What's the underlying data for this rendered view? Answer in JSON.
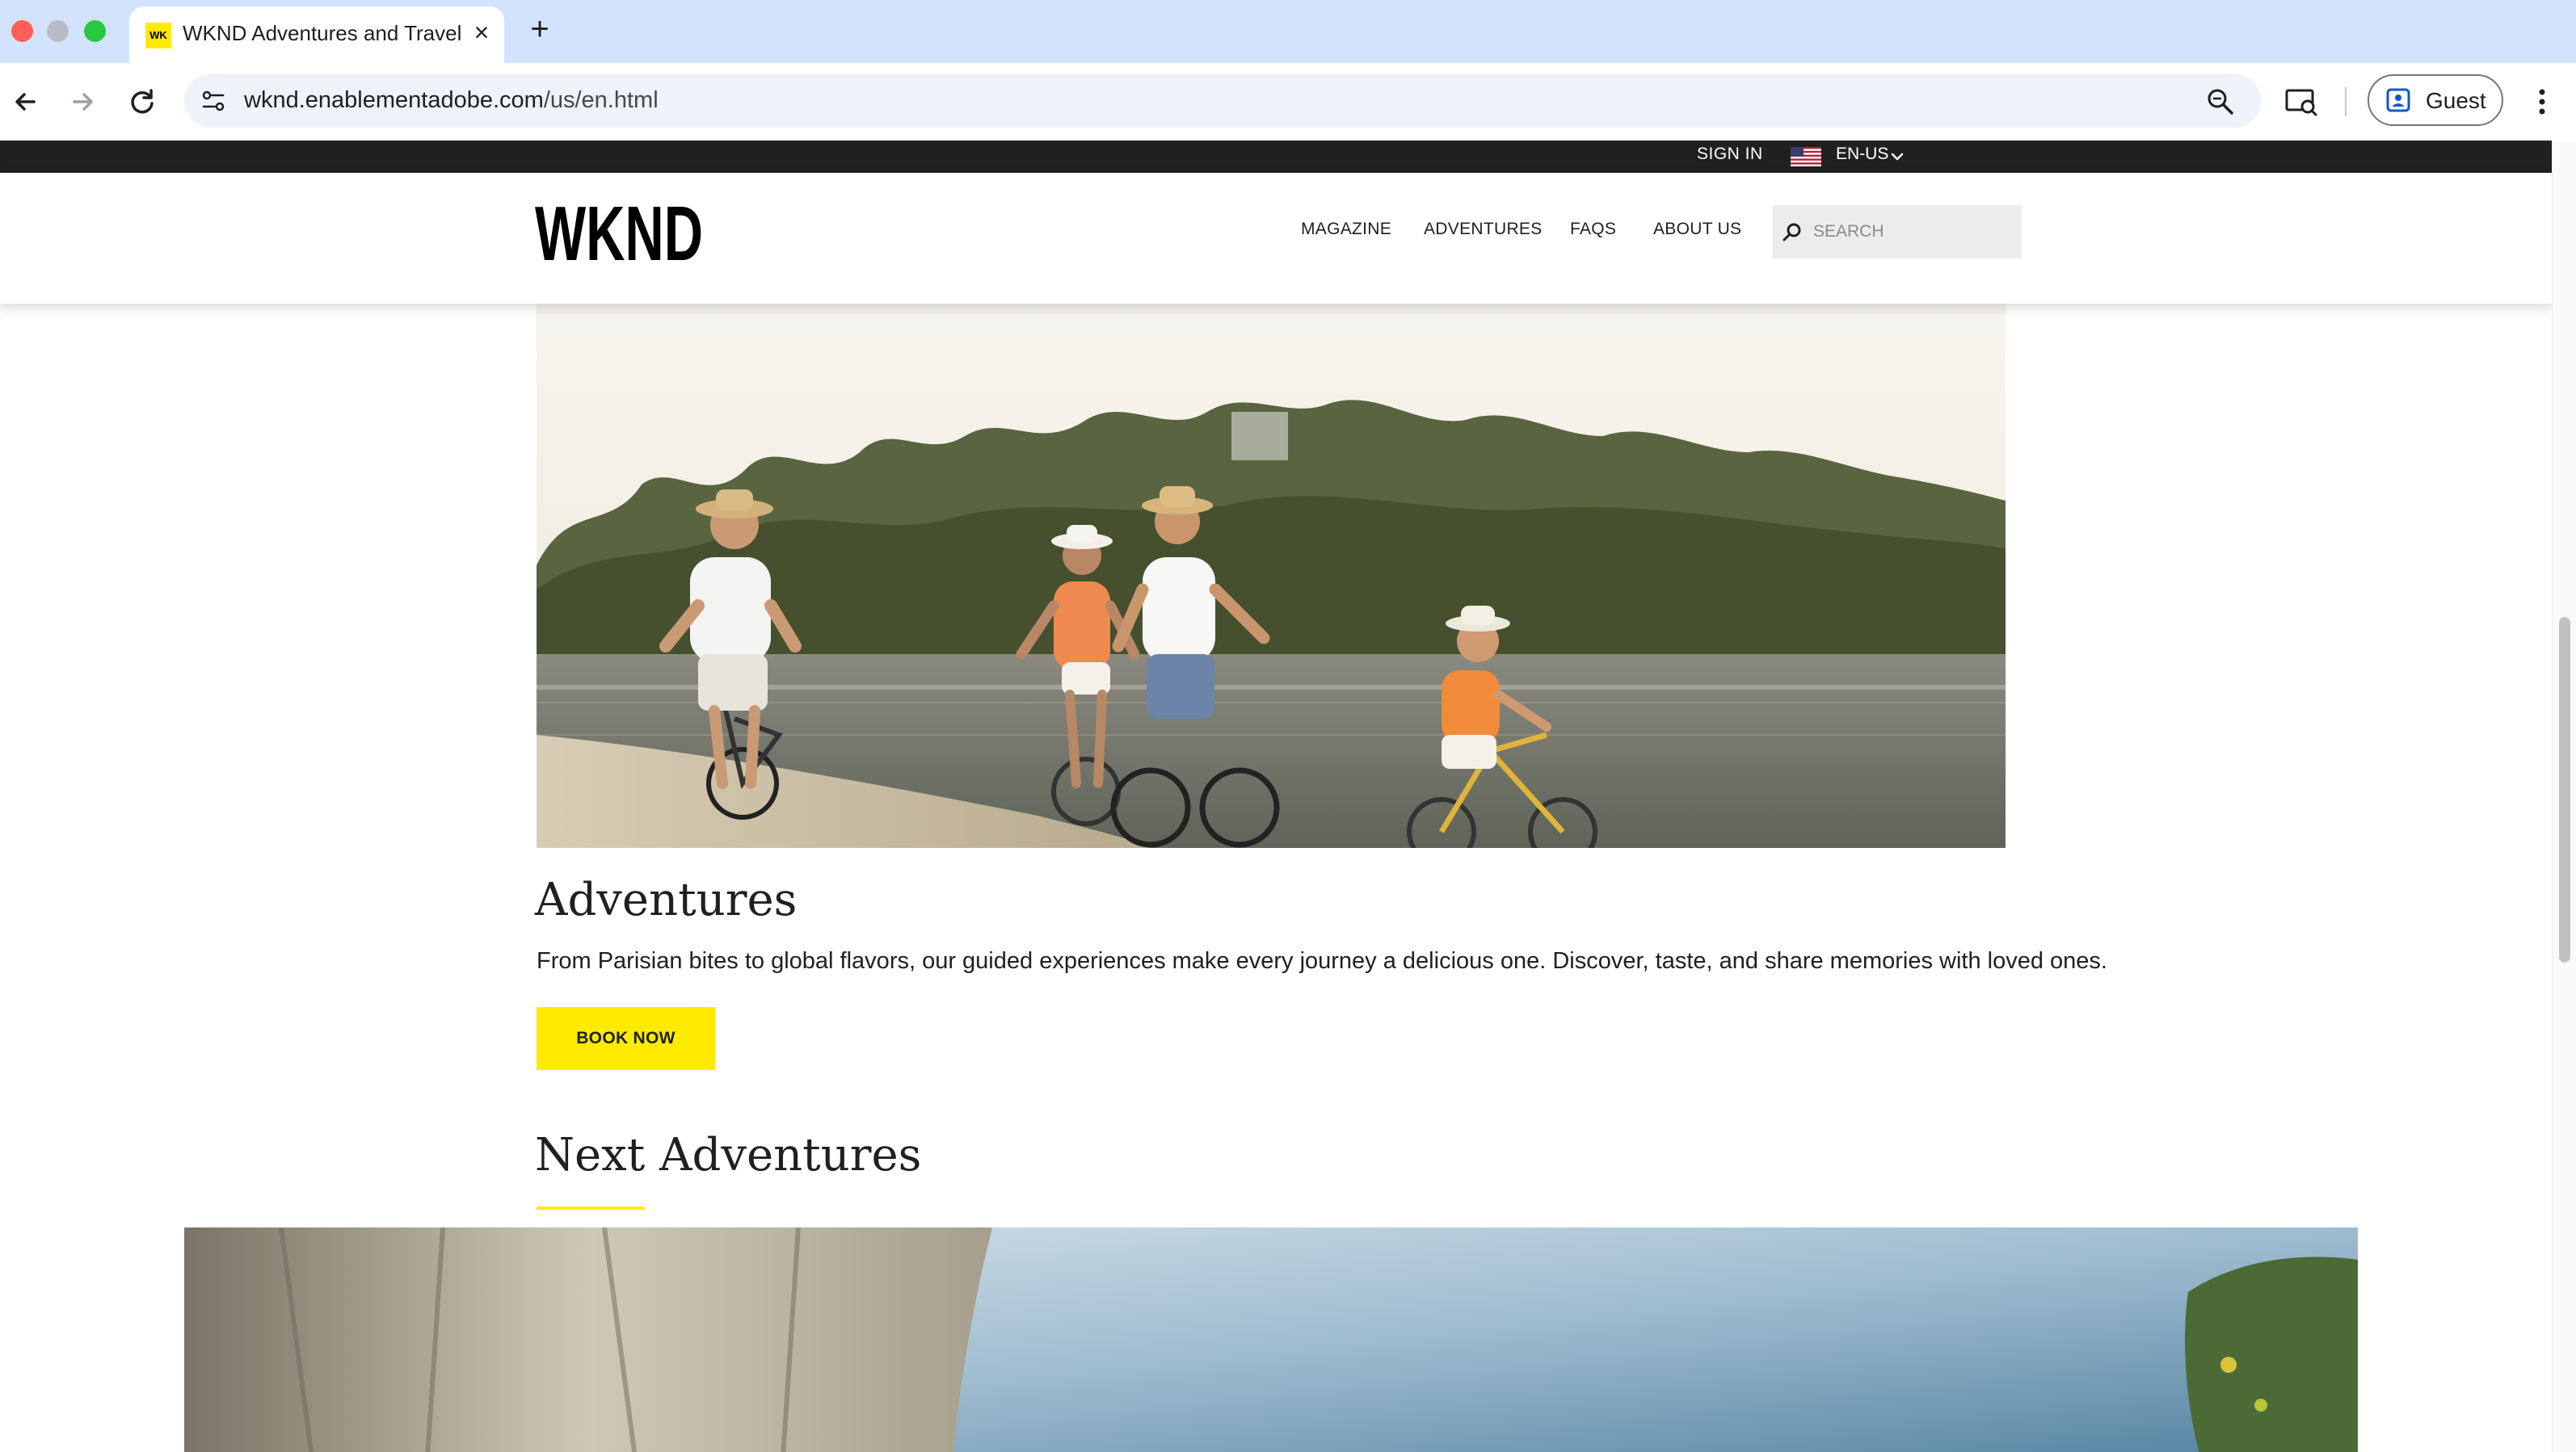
{
  "browser": {
    "tab_title": "WKND Adventures and Travel",
    "favicon_text": "WK",
    "url_host": "wknd.enablementadobe.com",
    "url_path": "/us/en.html",
    "profile_label": "Guest"
  },
  "utility_bar": {
    "sign_in": "SIGN IN",
    "language": "EN-US"
  },
  "header": {
    "logo": "WKND",
    "nav": [
      "MAGAZINE",
      "ADVENTURES",
      "FAQS",
      "ABOUT US"
    ],
    "search_placeholder": "SEARCH"
  },
  "hero": {
    "title": "Adventures",
    "description": "From Parisian bites to global flavors, our guided experiences make every journey a delicious one. Discover, taste, and share memories with loved ones.",
    "button_label": "BOOK NOW"
  },
  "next_section": {
    "title": "Next Adventures"
  },
  "colors": {
    "brand_yellow": "#ffea00",
    "utility_bar": "#202020",
    "tabbar": "#d3e3fd"
  }
}
